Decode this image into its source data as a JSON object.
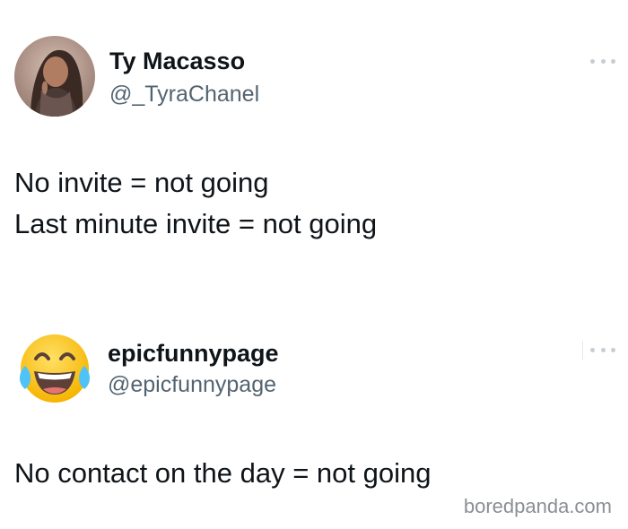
{
  "tweets": [
    {
      "display_name": "Ty Macasso",
      "handle": "@_TyraChanel",
      "avatar": "profile-photo",
      "more_icon": "more-horizontal-icon",
      "text_lines": [
        "No invite = not going",
        "Last minute invite = not going"
      ]
    },
    {
      "display_name": "epicfunnypage",
      "handle": "@epicfunnypage",
      "avatar": "face-with-tears-of-joy-emoji",
      "more_icon": "more-horizontal-icon",
      "text_lines": [
        "No contact on the day = not going"
      ]
    }
  ],
  "watermark": "boredpanda.com",
  "colors": {
    "text": "#0f1419",
    "handle": "#536471",
    "watermark": "#8b8f94",
    "emoji_yellow": "#fcc21b",
    "emoji_tears": "#4fc3f7"
  }
}
